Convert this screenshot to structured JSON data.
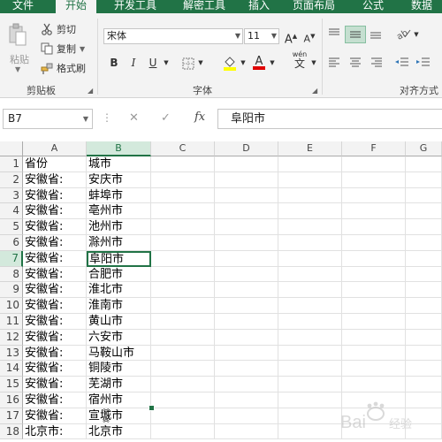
{
  "tabs": [
    "文件",
    "开始",
    "开发工具",
    "解密工具",
    "插入",
    "页面布局",
    "公式",
    "数据"
  ],
  "ribbon": {
    "clipboard": {
      "paste": "粘贴",
      "cut": "剪切",
      "copy": "复制",
      "format_painter": "格式刷",
      "group_label": "剪贴板"
    },
    "font": {
      "font_name": "宋体",
      "font_size": "11",
      "grow_symbol": "A",
      "shrink_symbol": "A",
      "bold": "B",
      "italic": "I",
      "underline": "U",
      "phonetic_label": "wén",
      "phonetic_char": "文",
      "group_label": "字体"
    },
    "alignment": {
      "group_label": "对齐方式"
    }
  },
  "formula_bar": {
    "name_box": "B7",
    "formula": "阜阳市",
    "fx": "fx"
  },
  "columns": [
    "A",
    "B",
    "C",
    "D",
    "E",
    "F",
    "G"
  ],
  "rows": [
    {
      "n": "1",
      "a": "省份",
      "b": "城市"
    },
    {
      "n": "2",
      "a": "安徽省:",
      "b": "安庆市"
    },
    {
      "n": "3",
      "a": "安徽省:",
      "b": "蚌埠市"
    },
    {
      "n": "4",
      "a": "安徽省:",
      "b": "亳州市"
    },
    {
      "n": "5",
      "a": "安徽省:",
      "b": "池州市"
    },
    {
      "n": "6",
      "a": "安徽省:",
      "b": "滁州市"
    },
    {
      "n": "7",
      "a": "安徽省:",
      "b": "阜阳市"
    },
    {
      "n": "8",
      "a": "安徽省:",
      "b": "合肥市"
    },
    {
      "n": "9",
      "a": "安徽省:",
      "b": "淮北市"
    },
    {
      "n": "10",
      "a": "安徽省:",
      "b": "淮南市"
    },
    {
      "n": "11",
      "a": "安徽省:",
      "b": "黄山市"
    },
    {
      "n": "12",
      "a": "安徽省:",
      "b": "六安市"
    },
    {
      "n": "13",
      "a": "安徽省:",
      "b": "马鞍山市"
    },
    {
      "n": "14",
      "a": "安徽省:",
      "b": "铜陵市"
    },
    {
      "n": "15",
      "a": "安徽省:",
      "b": "芜湖市"
    },
    {
      "n": "16",
      "a": "安徽省:",
      "b": "宿州市"
    },
    {
      "n": "17",
      "a": "安徽省:",
      "b": "宣城市"
    },
    {
      "n": "18",
      "a": "北京市:",
      "b": "北京市"
    }
  ],
  "active_cell": {
    "col": "B",
    "row": "7"
  },
  "watermark": "Bai 经验",
  "colors": {
    "accent": "#217346",
    "ribbon_bg": "#f3f3f3",
    "selection_header": "#d3e9dc"
  }
}
